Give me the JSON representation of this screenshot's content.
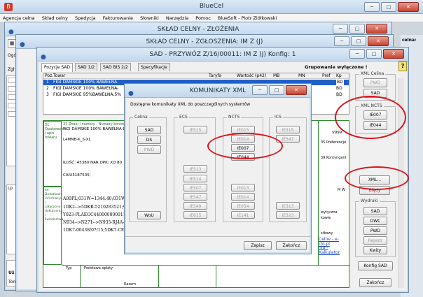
{
  "app": {
    "title": "BlueCel",
    "menu": [
      "Agencja celna",
      "Skład celny",
      "Spedycja",
      "Fakturowanie",
      "Słowniki",
      "Narzędzia",
      "Pomoc",
      "BlueSoft - Piotr Ziółkowski"
    ]
  },
  "window_zlozenia": {
    "title": "SKŁAD CELNY - ZŁOŻENIA"
  },
  "window_zgloszenia": {
    "title": "SKŁAD CELNY - ZGŁOSZENIA: IM Z  (J)"
  },
  "window_sad": {
    "title": "SAD - PRZYWÓZ      Z/16/00011: IM Z  (J)  Konfig: 1",
    "status": "Grupowanie wyłączone !",
    "tabs": [
      "Pozycje SAD",
      "SAD 1/2",
      "SAD BIS  2/2",
      "Specyfikacje"
    ],
    "columns": [
      "Poz.",
      "Towar",
      "Taryfa",
      "Wartość (p42)",
      "MB",
      "MN",
      "Pref",
      "Kp"
    ],
    "rows": [
      {
        "poz": "1",
        "towar": "FIGI DAMSKIE 100% BAWEŁNA-",
        "kp": "BD"
      },
      {
        "poz": "2",
        "towar": "FIGI DAMSKIE 100% BAWEŁNA-",
        "kp": "BD"
      },
      {
        "poz": "3",
        "towar": "FIGI DAMSKIE 95%BAWEŁNA,5%",
        "kp": "BD"
      }
    ],
    "box31_label": "31 Opakowania i opis towaru",
    "box31_head": "31 Znaki i numery - Numery kontenerów - Ilość i rodzaj",
    "box31_lines": [
      "FIGI DAMSKIE 100% BAWEŁNA-DO",
      "L4MNB-K_S-XL",
      "ILOŚĆ: 45380 NAR  OPK: XD 80",
      "CAIU3187535;"
    ],
    "box44_label": "44 Dodatkowe informacje / załączone dokumenty / świadectwa",
    "box44_lines": [
      "A00PL;031W=1344.40;031W",
      "1DK2-->5DKR-5210283521;9D",
      "Y023-PLAEOC4400000900118",
      "N934-->N271-->N935-RJ4A-00",
      "1DK7-00438/07/15;5DK7-CER"
    ],
    "typ_label": "Typ",
    "podstawa_label": "Podstawa opłaty",
    "razem_label": "Razem",
    "right_labels": [
      "V999",
      "35 Preferencje",
      "39 Kontyngent",
      "M W"
    ],
    "link1": "Celne - e-clo.pl",
    "link2": "nia - Kalkulator",
    "side_text": [
      "wytyczna",
      "kowie",
      "stkowy"
    ]
  },
  "sidebar": {
    "xml_celina_label": "XML Celina",
    "pwd": "PWD",
    "sad": "SAD",
    "xml_ncts_label": "XML NCTS",
    "ie007": "IE007",
    "ie044": "IE044",
    "xml_btn": "XML...",
    "bledy": "Błędy",
    "wydruki_label": "Wydruki",
    "w_sad": "SAD",
    "w_dwc": "DWC",
    "w_pwd": "PWD",
    "w_rejestr": "Rejestr",
    "w_kwity": "Kwity",
    "konfig": "Konfig SAD",
    "zakoncz": "Zakończ",
    "help": "?"
  },
  "dialog": {
    "title": "KOMUNIKATY XML",
    "subtitle": "Dostępne komunikaty XML do poszczególnych systemów",
    "celina_label": "Celina",
    "celina_buttons": [
      "SAD",
      "DS",
      "PWD"
    ],
    "wou": "WoU",
    "ecs_label": "ECS",
    "ecs_buttons": [
      "IE515",
      "IE513",
      "IE514",
      "IE507",
      "IE547",
      "IE549",
      "IE615"
    ],
    "ncts_label": "NCTS",
    "ncts_buttons": [
      "IE015",
      "IE014",
      "IE007",
      "IE044",
      "IE013",
      "IE014",
      "IE054",
      "IE141"
    ],
    "ics_label": "ICS",
    "ics_buttons": [
      "IE315",
      "IE347",
      "IE313",
      "IE323"
    ],
    "zapisz": "Zapisz",
    "zakoncz": "Zakończ"
  },
  "taskbar": {
    "items": [
      "Uż",
      "Tomat etc"
    ]
  },
  "left_snips": [
    "Ogó",
    "Zgł",
    "Lp",
    "Ogł",
    "1",
    "2",
    "3",
    "4",
    "5",
    "6"
  ],
  "right_snip": "celna:"
}
